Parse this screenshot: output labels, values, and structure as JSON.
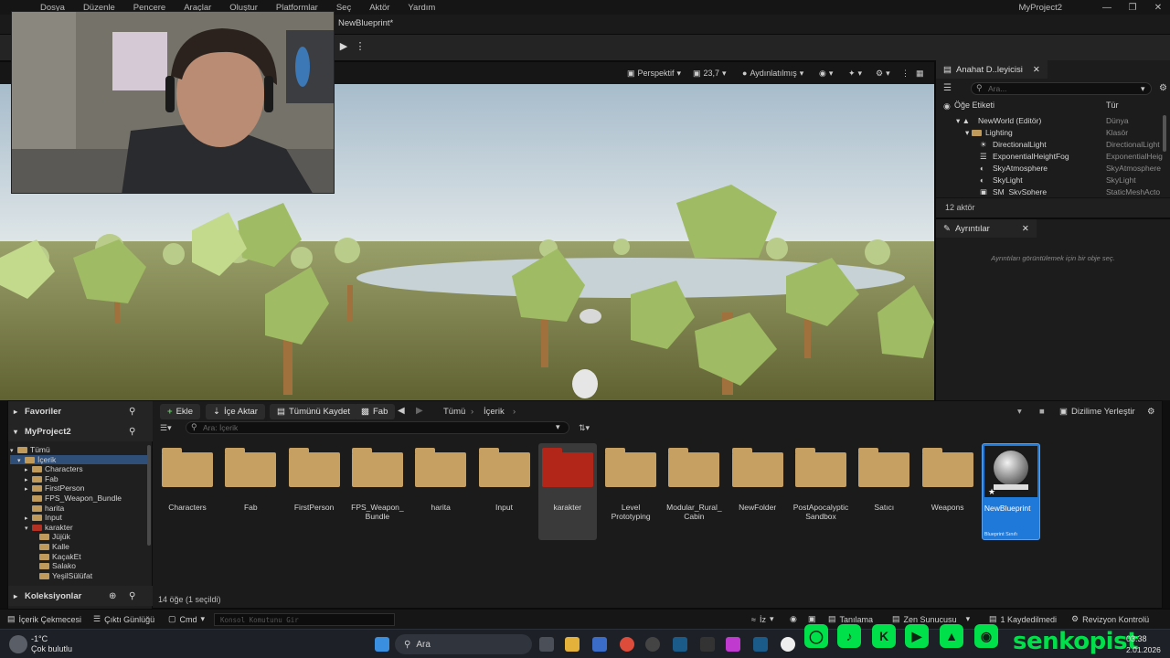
{
  "menu": {
    "items": [
      "Dosya",
      "Düzenle",
      "Pencere",
      "Araçlar",
      "Oluştur",
      "Platformlar",
      "Seç",
      "Aktör",
      "Yardım"
    ],
    "app_title": "MyProject2"
  },
  "editor_tab": {
    "label": "NewBlueprint*"
  },
  "viewport": {
    "perspective_label": "Perspektif",
    "fov_value": "23,7",
    "lighting_label": "Aydınlatılmış"
  },
  "outliner": {
    "tab_label": "Anahat D..leyicisi",
    "search_placeholder": "Ara...",
    "col_label": "Öğe Etiketi",
    "col_type": "Tür",
    "rows": [
      {
        "label": "NewWorld (Editör)",
        "type": "Dünya"
      },
      {
        "label": "Lighting",
        "type": "Klasör"
      },
      {
        "label": "DirectionalLight",
        "type": "DirectionalLight"
      },
      {
        "label": "ExponentialHeightFog",
        "type": "ExponentialHeig"
      },
      {
        "label": "SkyAtmosphere",
        "type": "SkyAtmosphere"
      },
      {
        "label": "SkyLight",
        "type": "SkyLight"
      },
      {
        "label": "SM_SkySphere",
        "type": "StaticMeshActo"
      }
    ],
    "count": "12 aktör"
  },
  "details": {
    "tab_label": "Ayrıntılar",
    "empty_text": "Ayrıntıları görüntülemek için bir obje seç."
  },
  "content_browser": {
    "favorites_label": "Favoriler",
    "project_label": "MyProject2",
    "collections_label": "Koleksiyonlar",
    "tree": [
      {
        "label": "Tümü",
        "indent": 0,
        "sel": false
      },
      {
        "label": "İçerik",
        "indent": 1,
        "sel": true
      },
      {
        "label": "Characters",
        "indent": 2,
        "sel": false
      },
      {
        "label": "Fab",
        "indent": 2,
        "sel": false
      },
      {
        "label": "FirstPerson",
        "indent": 2,
        "sel": false
      },
      {
        "label": "FPS_Weapon_Bundle",
        "indent": 2,
        "sel": false
      },
      {
        "label": "harita",
        "indent": 2,
        "sel": false
      },
      {
        "label": "Input",
        "indent": 2,
        "sel": false
      },
      {
        "label": "karakter",
        "indent": 2,
        "sel": false
      },
      {
        "label": "Jüjük",
        "indent": 3,
        "sel": false
      },
      {
        "label": "Kalle",
        "indent": 3,
        "sel": false
      },
      {
        "label": "KaçakEt",
        "indent": 3,
        "sel": false
      },
      {
        "label": "Salako",
        "indent": 3,
        "sel": false
      },
      {
        "label": "YeşilSülüfat",
        "indent": 3,
        "sel": false
      }
    ],
    "buttons": {
      "add": "Ekle",
      "import": "İçe Aktar",
      "save_all": "Tümünü Kaydet",
      "fab": "Fab",
      "dock": "Dizilime Yerleştir"
    },
    "breadcrumb": [
      "Tümü",
      "İçerik"
    ],
    "search_placeholder": "Ara: İçerik",
    "assets": [
      {
        "name": "Characters",
        "kind": "folder"
      },
      {
        "name": "Fab",
        "kind": "folder"
      },
      {
        "name": "FirstPerson",
        "kind": "folder"
      },
      {
        "name": "FPS_Weapon_ Bundle",
        "kind": "folder"
      },
      {
        "name": "harita",
        "kind": "folder"
      },
      {
        "name": "Input",
        "kind": "folder"
      },
      {
        "name": "karakter",
        "kind": "folder-selected"
      },
      {
        "name": "Level Prototyping",
        "kind": "folder"
      },
      {
        "name": "Modular_Rural_ Cabin",
        "kind": "folder"
      },
      {
        "name": "NewFolder",
        "kind": "folder"
      },
      {
        "name": "PostApocalyptic Sandbox",
        "kind": "folder"
      },
      {
        "name": "Satıcı",
        "kind": "folder"
      },
      {
        "name": "Weapons",
        "kind": "folder"
      },
      {
        "name": "NewBlueprint",
        "kind": "blueprint",
        "sub": "Blueprint Sınıfı"
      }
    ],
    "item_count": "14 öğe (1 seçildi)"
  },
  "statusbar": {
    "content_drawer": "İçerik Çekmecesi",
    "output_log": "Çıktı Günlüğü",
    "cmd": "Cmd",
    "console_placeholder": "Konsol Komutunu Gir",
    "trace": "İz",
    "diagnostics": "Tanılama",
    "zen": "Zen Sunucusu",
    "saved": "1 Kaydedilmedi",
    "revision": "Revizyon Kontrolü"
  },
  "taskbar": {
    "weather_temp": "-1°C",
    "weather_desc": "Çok bulutlu",
    "search_label": "Ara",
    "time": "03:38",
    "date": "2.01.2026",
    "social_name": "senkopist"
  }
}
